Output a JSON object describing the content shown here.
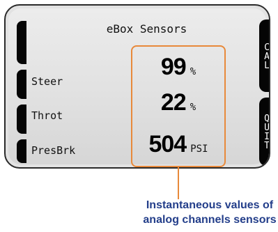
{
  "screen": {
    "title": "eBox Sensors"
  },
  "sensors": [
    {
      "label": "Steer",
      "value": "99",
      "unit": "%"
    },
    {
      "label": "Throt",
      "value": "22",
      "unit": "%"
    },
    {
      "label": "PresBrk",
      "value": "504",
      "unit": "PSI"
    }
  ],
  "softkeys": {
    "cal_label": "CAL",
    "quit_label": "QUIT"
  },
  "annotation": {
    "line1": "Instantaneous values of",
    "line2": "analog channels sensors"
  },
  "colors": {
    "highlight_box": "#e8893a",
    "caption_text": "#233e8a",
    "screen_bg": "#e2e2e2"
  }
}
